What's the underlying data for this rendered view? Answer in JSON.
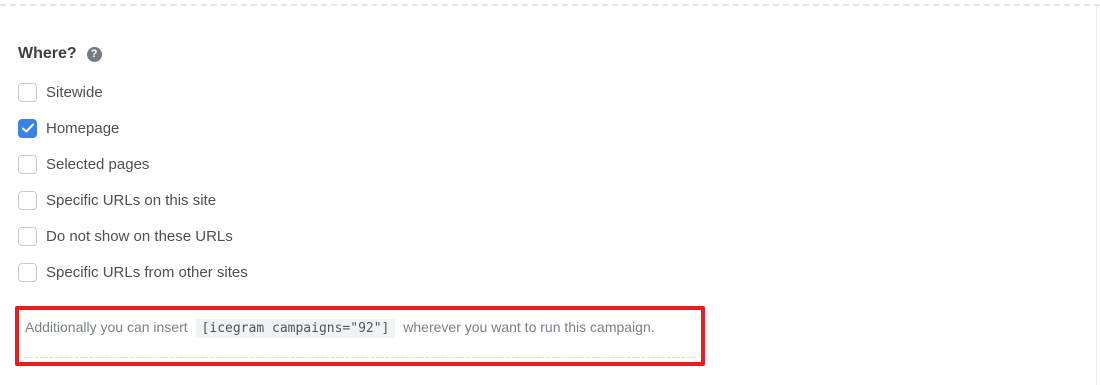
{
  "section": {
    "heading": "Where?",
    "help_icon": "?"
  },
  "options": [
    {
      "label": "Sitewide",
      "checked": false
    },
    {
      "label": "Homepage",
      "checked": true
    },
    {
      "label": "Selected pages",
      "checked": false
    },
    {
      "label": "Specific URLs on this site",
      "checked": false
    },
    {
      "label": "Do not show on these URLs",
      "checked": false
    },
    {
      "label": "Specific URLs from other sites",
      "checked": false
    }
  ],
  "shortcode": {
    "before": "Additionally you can insert",
    "code": "[icegram campaigns=\"92\"]",
    "after": "wherever you want to run this campaign."
  },
  "colors": {
    "checkbox_checked": "#3b82e8",
    "highlight_border": "#ef1b1b"
  }
}
